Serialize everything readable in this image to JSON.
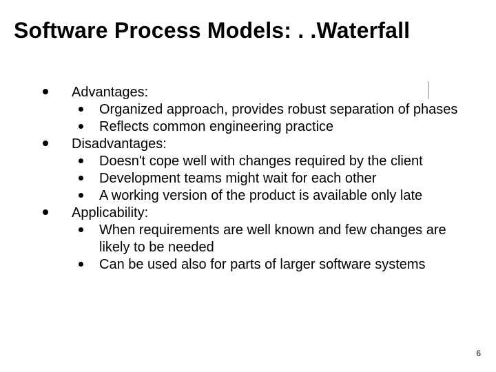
{
  "slide": {
    "title": "Software Process Models: . .Waterfall",
    "sections": [
      {
        "heading": "Advantages:",
        "items": [
          "Organized approach, provides robust separation of phases",
          "Reflects common engineering practice"
        ]
      },
      {
        "heading": "Disadvantages:",
        "items": [
          "Doesn't cope well with changes required by the client",
          "Development teams might wait for each other",
          "A working version of the product is available only late"
        ]
      },
      {
        "heading": "Applicability:",
        "items": [
          "When requirements are well known and few changes are likely to be needed",
          "Can be used also for parts of larger software systems"
        ]
      }
    ],
    "page_number": "6"
  }
}
